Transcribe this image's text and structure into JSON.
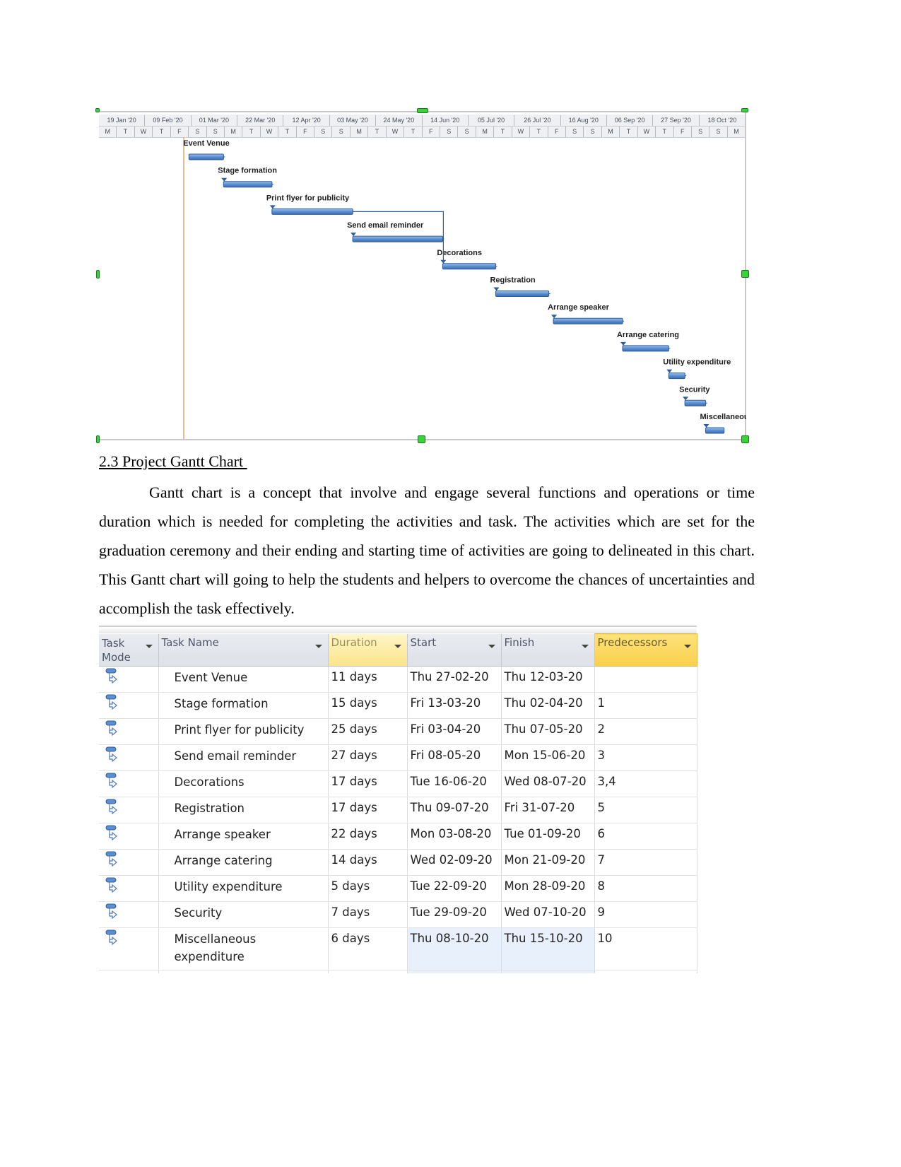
{
  "chart_data": {
    "type": "gantt",
    "title": "",
    "timescale_top": [
      "19 Jan '20",
      "09 Feb '20",
      "01 Mar '20",
      "22 Mar '20",
      "12 Apr '20",
      "03 May '20",
      "24 May '20",
      "14 Jun '20",
      "05 Jul '20",
      "26 Jul '20",
      "16 Aug '20",
      "06 Sep '20",
      "27 Sep '20",
      "18 Oct '20"
    ],
    "timescale_bottom": [
      "M",
      "T",
      "W",
      "T",
      "F",
      "S",
      "S",
      "M",
      "T",
      "W",
      "T",
      "F",
      "S",
      "S",
      "M",
      "T",
      "W",
      "T",
      "F",
      "S",
      "S",
      "M",
      "T",
      "W",
      "T",
      "F",
      "S",
      "S",
      "M",
      "T",
      "W",
      "T",
      "F",
      "S",
      "S",
      "M"
    ],
    "today_marker_date": "27-02-20",
    "tasks": [
      {
        "id": 1,
        "label": "Event Venue",
        "start": "2020-02-27",
        "finish": "2020-03-12",
        "predecessors": []
      },
      {
        "id": 2,
        "label": "Stage formation",
        "start": "2020-03-13",
        "finish": "2020-04-02",
        "predecessors": [
          1
        ]
      },
      {
        "id": 3,
        "label": "Print flyer for publicity",
        "start": "2020-04-03",
        "finish": "2020-05-07",
        "predecessors": [
          2
        ]
      },
      {
        "id": 4,
        "label": "Send email reminder",
        "start": "2020-05-08",
        "finish": "2020-06-15",
        "predecessors": [
          3
        ]
      },
      {
        "id": 5,
        "label": "Decorations",
        "start": "2020-06-16",
        "finish": "2020-07-08",
        "predecessors": [
          3,
          4
        ]
      },
      {
        "id": 6,
        "label": "Registration",
        "start": "2020-07-09",
        "finish": "2020-07-31",
        "predecessors": [
          5
        ]
      },
      {
        "id": 7,
        "label": "Arrange speaker",
        "start": "2020-08-03",
        "finish": "2020-09-01",
        "predecessors": [
          6
        ]
      },
      {
        "id": 8,
        "label": "Arrange catering",
        "start": "2020-09-02",
        "finish": "2020-09-21",
        "predecessors": [
          7
        ]
      },
      {
        "id": 9,
        "label": "Utility expenditure",
        "start": "2020-09-22",
        "finish": "2020-09-28",
        "predecessors": [
          8
        ]
      },
      {
        "id": 10,
        "label": "Security",
        "start": "2020-09-29",
        "finish": "2020-10-07",
        "predecessors": [
          9
        ]
      },
      {
        "id": 11,
        "label": "Miscellaneous expenditure",
        "start": "2020-10-08",
        "finish": "2020-10-15",
        "predecessors": [
          10
        ]
      }
    ],
    "x_range": [
      "2020-01-19",
      "2020-10-25"
    ],
    "colors": {
      "bar": "#5b8fd1",
      "bar_border": "#2f5d9b",
      "link": "#2f5d9b",
      "today_line": "#f5b88a"
    }
  },
  "section": {
    "heading": "2.3 Project Gantt Chart ",
    "paragraph": "Gantt chart is a concept that involve and engage several functions and operations or time duration which is needed for completing the activities and task. The activities which are set for the graduation ceremony and their ending and starting time of activities are going to delineated in this chart. This Gantt chart will going to help the students and helpers to overcome the chances of uncertainties and accomplish the task effectively."
  },
  "table": {
    "headers": {
      "mode": "Task Mode",
      "name": "Task Name",
      "duration": "Duration",
      "start": "Start",
      "finish": "Finish",
      "predecessors": "Predecessors"
    },
    "rows": [
      {
        "name": "Event Venue",
        "duration": "11 days",
        "start": "Thu 27-02-20",
        "finish": "Thu 12-03-20",
        "pred": ""
      },
      {
        "name": "Stage formation",
        "duration": "15 days",
        "start": "Fri 13-03-20",
        "finish": "Thu 02-04-20",
        "pred": "1"
      },
      {
        "name": "Print flyer for publicity",
        "duration": "25 days",
        "start": "Fri 03-04-20",
        "finish": "Thu 07-05-20",
        "pred": "2"
      },
      {
        "name": "Send email reminder",
        "duration": "27 days",
        "start": "Fri 08-05-20",
        "finish": "Mon 15-06-20",
        "pred": "3"
      },
      {
        "name": "Decorations",
        "duration": "17 days",
        "start": "Tue 16-06-20",
        "finish": "Wed 08-07-20",
        "pred": "3,4"
      },
      {
        "name": "Registration",
        "duration": "17 days",
        "start": "Thu 09-07-20",
        "finish": "Fri 31-07-20",
        "pred": "5"
      },
      {
        "name": "Arrange speaker",
        "duration": "22 days",
        "start": "Mon 03-08-20",
        "finish": "Tue 01-09-20",
        "pred": "6"
      },
      {
        "name": "Arrange catering",
        "duration": "14 days",
        "start": "Wed 02-09-20",
        "finish": "Mon 21-09-20",
        "pred": "7"
      },
      {
        "name": "Utility expenditure",
        "duration": "5 days",
        "start": "Tue 22-09-20",
        "finish": "Mon 28-09-20",
        "pred": "8"
      },
      {
        "name": "Security",
        "duration": "7 days",
        "start": "Tue 29-09-20",
        "finish": "Wed 07-10-20",
        "pred": "9"
      },
      {
        "name": "Miscellaneous expenditure",
        "duration": "6 days",
        "start": "Thu 08-10-20",
        "finish": "Thu 15-10-20",
        "pred": "10"
      }
    ],
    "selected_columns": [
      "start",
      "finish"
    ],
    "selected_row": 10
  }
}
